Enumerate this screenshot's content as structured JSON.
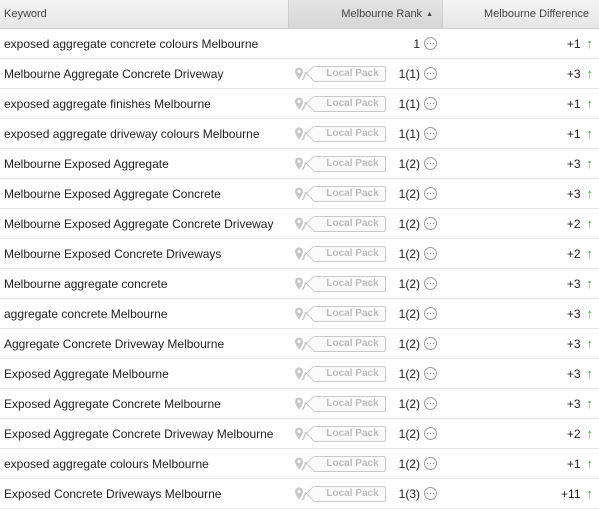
{
  "header": {
    "keyword": "Keyword",
    "rank": "Melbourne Rank",
    "sort_icon": "sort-ascending-icon",
    "difference": "Melbourne Difference"
  },
  "local_pack_label": "Local Pack",
  "colors": {
    "up": "#3aa63a",
    "pill_text": "#bcbcbc"
  },
  "rows": [
    {
      "keyword": "exposed aggregate concrete colours Melbourne",
      "local_pack": false,
      "rank": "1",
      "difference": "+1"
    },
    {
      "keyword": "Melbourne Aggregate Concrete Driveway",
      "local_pack": true,
      "rank": "1(1)",
      "difference": "+3"
    },
    {
      "keyword": "exposed aggregate finishes Melbourne",
      "local_pack": true,
      "rank": "1(1)",
      "difference": "+1"
    },
    {
      "keyword": "exposed aggregate driveway colours Melbourne",
      "local_pack": true,
      "rank": "1(1)",
      "difference": "+1"
    },
    {
      "keyword": "Melbourne Exposed Aggregate",
      "local_pack": true,
      "rank": "1(2)",
      "difference": "+3"
    },
    {
      "keyword": "Melbourne Exposed Aggregate Concrete",
      "local_pack": true,
      "rank": "1(2)",
      "difference": "+3"
    },
    {
      "keyword": "Melbourne Exposed Aggregate Concrete Driveway",
      "local_pack": true,
      "rank": "1(2)",
      "difference": "+2"
    },
    {
      "keyword": "Melbourne Exposed Concrete Driveways",
      "local_pack": true,
      "rank": "1(2)",
      "difference": "+2"
    },
    {
      "keyword": "Melbourne aggregate concrete",
      "local_pack": true,
      "rank": "1(2)",
      "difference": "+3"
    },
    {
      "keyword": "aggregate concrete Melbourne",
      "local_pack": true,
      "rank": "1(2)",
      "difference": "+3"
    },
    {
      "keyword": "Aggregate Concrete Driveway Melbourne",
      "local_pack": true,
      "rank": "1(2)",
      "difference": "+3"
    },
    {
      "keyword": "Exposed Aggregate Melbourne",
      "local_pack": true,
      "rank": "1(2)",
      "difference": "+3"
    },
    {
      "keyword": "Exposed Aggregate Concrete Melbourne",
      "local_pack": true,
      "rank": "1(2)",
      "difference": "+3"
    },
    {
      "keyword": "Exposed Aggregate Concrete Driveway Melbourne",
      "local_pack": true,
      "rank": "1(2)",
      "difference": "+2"
    },
    {
      "keyword": "exposed aggregate colours Melbourne",
      "local_pack": true,
      "rank": "1(2)",
      "difference": "+1"
    },
    {
      "keyword": "Exposed Concrete Driveways Melbourne",
      "local_pack": true,
      "rank": "1(3)",
      "difference": "+11"
    }
  ]
}
